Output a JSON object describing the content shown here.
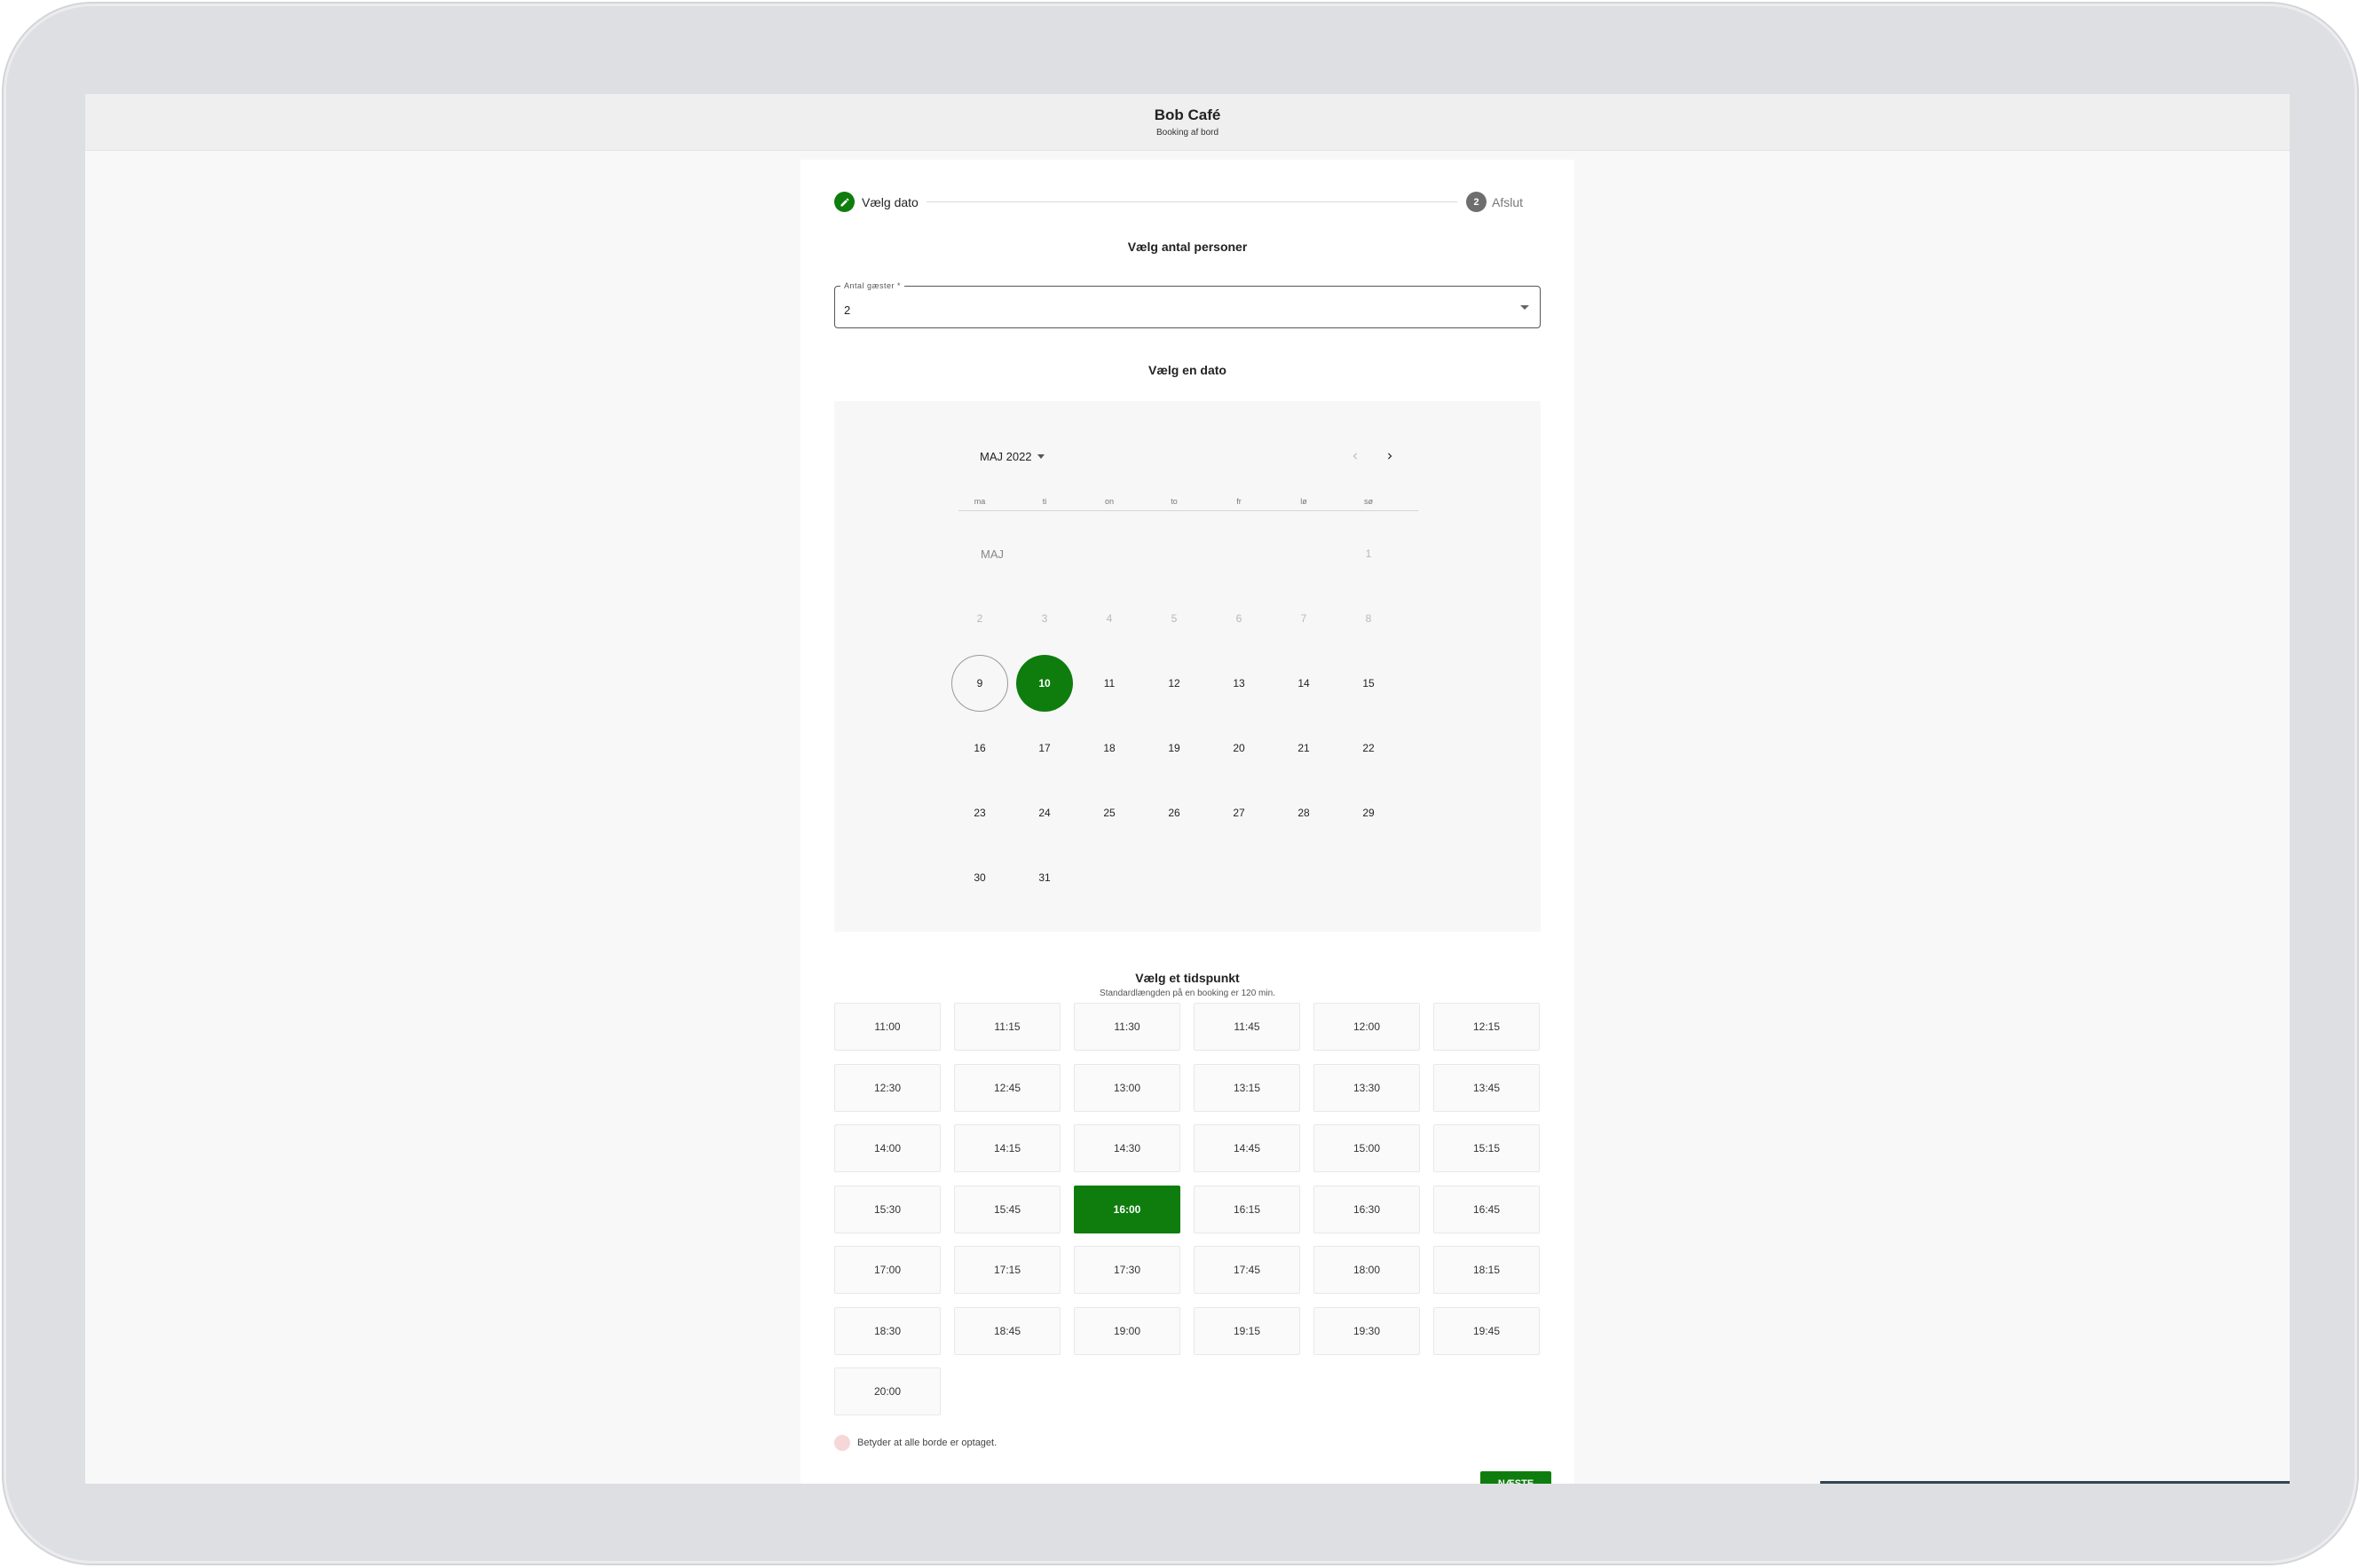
{
  "header": {
    "title": "Bob Café",
    "subtitle": "Booking af bord"
  },
  "stepper": {
    "steps": [
      {
        "label": "Vælg dato",
        "state": "done",
        "icon": "pencil-icon"
      },
      {
        "label": "Afslut",
        "number": "2"
      }
    ]
  },
  "persons": {
    "title": "Vælg antal personer",
    "field_label": "Antal gæster *",
    "value": "2"
  },
  "date": {
    "title": "Vælg en dato",
    "month_label": "MAJ 2022",
    "weekdays": [
      "ma",
      "ti",
      "on",
      "to",
      "fr",
      "lø",
      "sø"
    ],
    "section_label": "MAJ",
    "weeks": [
      [
        "",
        "",
        "",
        "",
        "",
        "",
        "1"
      ],
      [
        "2",
        "3",
        "4",
        "5",
        "6",
        "7",
        "8"
      ],
      [
        "9",
        "10",
        "11",
        "12",
        "13",
        "14",
        "15"
      ],
      [
        "16",
        "17",
        "18",
        "19",
        "20",
        "21",
        "22"
      ],
      [
        "23",
        "24",
        "25",
        "26",
        "27",
        "28",
        "29"
      ],
      [
        "30",
        "31",
        "",
        "",
        "",
        "",
        ""
      ]
    ],
    "today": "9",
    "selected": "10",
    "disabled_until": 8
  },
  "time": {
    "title": "Vælg et tidspunkt",
    "subtitle": "Standardlængden på en booking er 120 min.",
    "slots": [
      "11:00",
      "11:15",
      "11:30",
      "11:45",
      "12:00",
      "12:15",
      "12:30",
      "12:45",
      "13:00",
      "13:15",
      "13:30",
      "13:45",
      "14:00",
      "14:15",
      "14:30",
      "14:45",
      "15:00",
      "15:15",
      "15:30",
      "15:45",
      "16:00",
      "16:15",
      "16:30",
      "16:45",
      "17:00",
      "17:15",
      "17:30",
      "17:45",
      "18:00",
      "18:15",
      "18:30",
      "18:45",
      "19:00",
      "19:15",
      "19:30",
      "19:45",
      "20:00"
    ],
    "selected": "16:00"
  },
  "legend": {
    "text": "Betyder at alle borde er optaget."
  },
  "actions": {
    "next_label": "NÆSTE"
  },
  "colors": {
    "accent": "#0e7d0e",
    "occupied": "#f6d6d6"
  }
}
